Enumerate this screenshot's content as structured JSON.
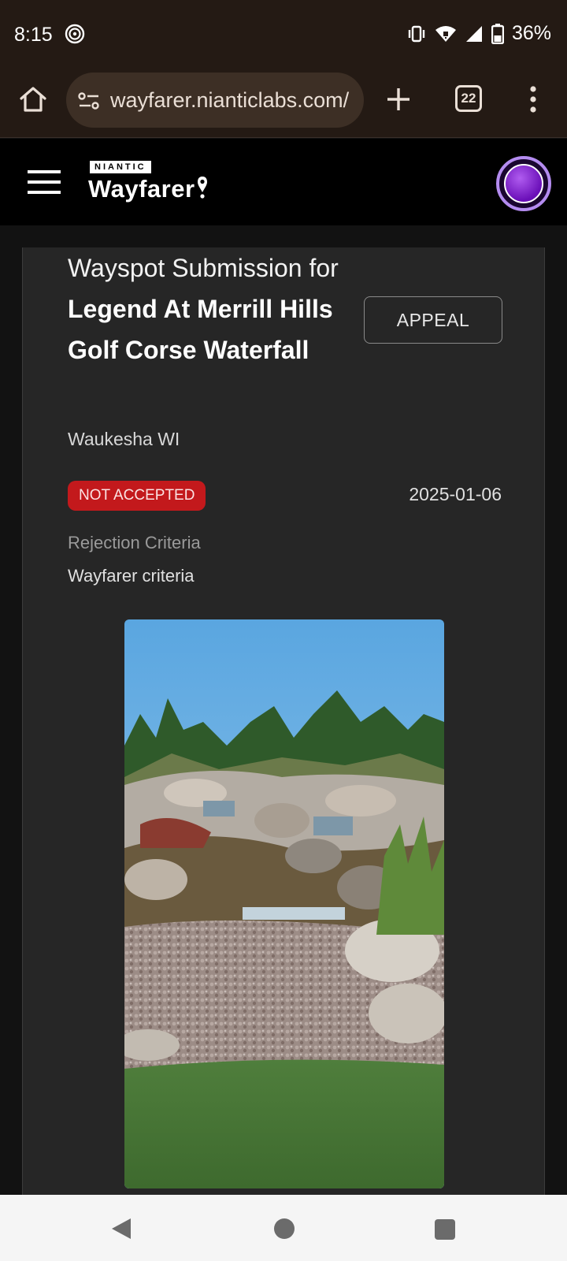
{
  "status_bar": {
    "time": "8:15",
    "battery": "36%",
    "icons": [
      "fingerprint-icon",
      "vibrate-icon",
      "wifi-icon",
      "signal-icon",
      "battery-icon"
    ]
  },
  "browser": {
    "url": "wayfarer.nianticlabs.com/",
    "tab_count": "22",
    "icons": [
      "home-icon",
      "site-settings-icon",
      "new-tab-icon",
      "tabs-icon",
      "more-vert-icon"
    ]
  },
  "app": {
    "brand_small": "NIANTIC",
    "brand_name": "Wayfarer"
  },
  "submission": {
    "title_prefix": "Wayspot Submission for",
    "title_name": "Legend At Merrill Hills Golf Corse Waterfall",
    "appeal_label": "APPEAL",
    "location": "Waukesha WI",
    "status": "NOT ACCEPTED",
    "date": "2025-01-06",
    "rejection_label": "Rejection Criteria",
    "rejection_value": "Wayfarer criteria"
  },
  "colors": {
    "status_bar_bg": "#241a14",
    "url_pill_bg": "#3d2f25",
    "header_bg": "#000000",
    "card_bg": "#262626",
    "status_badge": "#c3191c",
    "avatar_ring": "#b48cf0"
  }
}
